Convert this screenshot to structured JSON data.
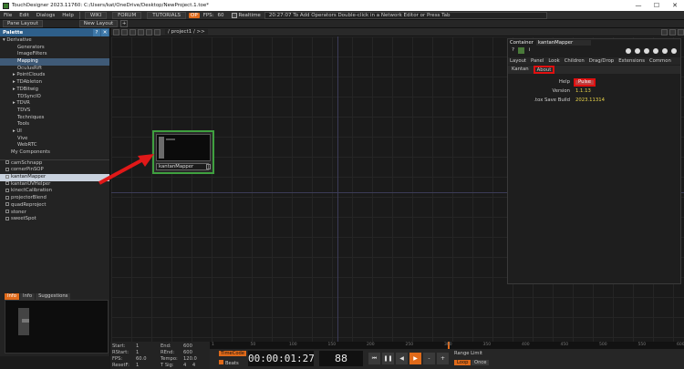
{
  "window": {
    "title": "TouchDesigner 2023.11760: C:/Users/kat/OneDrive/Desktop/NewProject.1.toe*",
    "min_glyph": "—",
    "max_glyph": "☐",
    "close_glyph": "✕"
  },
  "menu": {
    "items": [
      "File",
      "Edit",
      "Dialogs",
      "Help"
    ],
    "tabs": [
      "WIKI",
      "FORUM",
      "TUTORIALS"
    ],
    "badge": "OP",
    "fps_label": "FPS:",
    "fps_value": "60",
    "realtime_label": "Realtime",
    "status_message": "20:27:07 To Add Operators Double-click in a Network Editor or Press Tab"
  },
  "panebar": {
    "pane_layout_label": "Pane Layout",
    "new_layout_label": "New Layout",
    "plus": "+"
  },
  "palette": {
    "title": "Palette",
    "help_icon": "?",
    "close_icon": "✕",
    "tree": [
      {
        "label": "▾ Derivative",
        "level": "l0"
      },
      {
        "label": "Generators",
        "level": "l1"
      },
      {
        "label": "ImageFilters",
        "level": "l1"
      },
      {
        "label": "Mapping",
        "level": "l1",
        "selected": true
      },
      {
        "label": "OculusRift",
        "level": "l1"
      },
      {
        "label": "▸ PointClouds",
        "level": "l1a"
      },
      {
        "label": "▸ TDAbleton",
        "level": "l1a"
      },
      {
        "label": "▸ TDBitwig",
        "level": "l1a"
      },
      {
        "label": "TDSyncIO",
        "level": "l1"
      },
      {
        "label": "▸ TDVR",
        "level": "l1a"
      },
      {
        "label": "TDVS",
        "level": "l1"
      },
      {
        "label": "Techniques",
        "level": "l1"
      },
      {
        "label": "Tools",
        "level": "l1"
      },
      {
        "label": "▸ UI",
        "level": "l1a"
      },
      {
        "label": "Vive",
        "level": "l1"
      },
      {
        "label": "WebRTC",
        "level": "l1"
      },
      {
        "label": "My Components",
        "level": "l1n"
      }
    ],
    "components": [
      {
        "label": "camSchnapp"
      },
      {
        "label": "cornerPinSOP"
      },
      {
        "label": "kantanMapper",
        "selected": true
      },
      {
        "label": "kantanUVHelper"
      },
      {
        "label": "kinectCalibration"
      },
      {
        "label": "projectorBlend"
      },
      {
        "label": "quadReproject"
      },
      {
        "label": "stoner"
      },
      {
        "label": "sweetSpot"
      }
    ],
    "tabs": [
      "Info",
      "Info",
      "Suggestions"
    ]
  },
  "network": {
    "path": "/ project1 / >>",
    "node_label": "kantanMapper"
  },
  "params": {
    "type_label": "Container",
    "name": "kantanMapper",
    "tool_help": "?",
    "tool_info": "i",
    "tabs": [
      "Layout",
      "Panel",
      "Look",
      "Children",
      "Drag/Drop",
      "Extensions",
      "Common"
    ],
    "subtabs": [
      "Kantan",
      "About"
    ],
    "help_label": "Help",
    "help_button": "Pulse",
    "version_label": "Version",
    "version_value": "1.1.13",
    "build_label": ".tox Save Build",
    "build_value": "2023.11314"
  },
  "timeline": {
    "start_label": "Start:",
    "start_value": "1",
    "end_label": "End:",
    "end_value": "600",
    "rstart_label": "RStart:",
    "rstart_value": "1",
    "rend_label": "REnd:",
    "rend_value": "600",
    "fps_label": "FPS:",
    "fps_value": "60.0",
    "tempo_label": "Tempo:",
    "tempo_value": "120.0",
    "reset_label": "ResetF:",
    "reset_value": "1",
    "tsig_label": "T Sig:",
    "tsig_value": "4    4",
    "timecode_button": "TimeCode",
    "beats_label": "Beats",
    "timecode": "00:00:01:27",
    "frame": "88",
    "range_limit_label": "Range Limit",
    "loop_label": "Loop",
    "once_label": "Once",
    "ticks": [
      "1",
      "50",
      "100",
      "150",
      "200",
      "250",
      "300",
      "350",
      "400",
      "450",
      "500",
      "550",
      "600"
    ]
  }
}
